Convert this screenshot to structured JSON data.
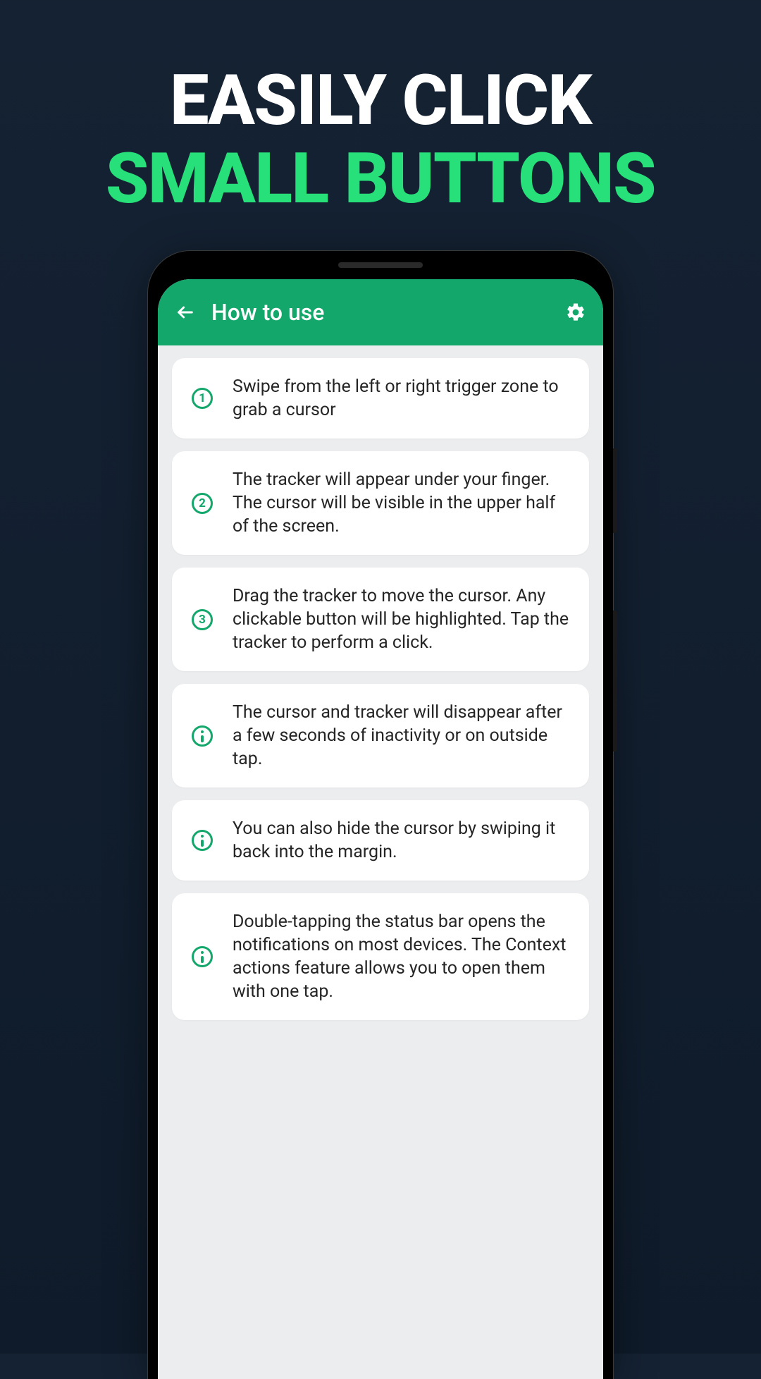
{
  "headline": {
    "line1": "EASILY CLICK",
    "line2": "SMALL BUTTONS"
  },
  "colors": {
    "accent": "#27e079",
    "appbar": "#14a76c",
    "background": "#152233"
  },
  "app": {
    "title": "How to use",
    "steps": [
      {
        "icon": "1",
        "text": "Swipe from the left or right trigger zone to grab a cursor"
      },
      {
        "icon": "2",
        "text": "The tracker will appear under your finger. The cursor will be visible in the upper half of the screen."
      },
      {
        "icon": "3",
        "text": "Drag the tracker to move the cursor. Any clickable button will be highlighted. Tap the tracker to perform a click."
      },
      {
        "icon": "i",
        "text": "The cursor and tracker will disappear after a few seconds of inactivity or on outside tap."
      },
      {
        "icon": "i",
        "text": "You can also hide the cursor by swiping it back into the margin."
      },
      {
        "icon": "i",
        "text": "Double-tapping the status bar opens the notifications on most devices. The Context actions feature allows you to open them with one tap."
      }
    ]
  }
}
